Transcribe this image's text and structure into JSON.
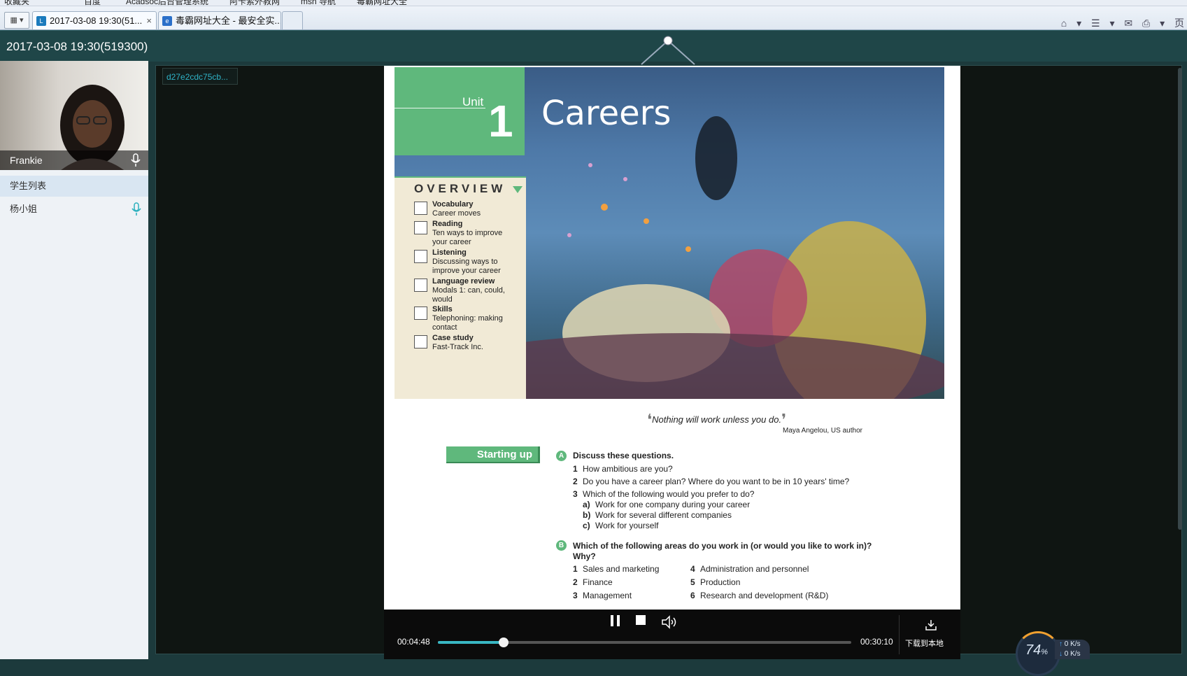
{
  "browser": {
    "favorites": [
      "收藏夹",
      "百度",
      "Acadsoc后台管理系统",
      "阿卡索外教网",
      "msn 导航",
      "毒霸网址大全"
    ],
    "tab_control": "▾",
    "tabs": [
      {
        "label": "2017-03-08 19:30(51...",
        "close": "×"
      },
      {
        "label": "毒霸网址大全 - 最安全实..."
      }
    ],
    "tools": [
      "⌂",
      "▾",
      "☰",
      "▾",
      "✉",
      "⎙",
      "▾",
      "页"
    ]
  },
  "app": {
    "title": "2017-03-08 19:30(519300)",
    "doc_id": "d27e2cdc75cb..."
  },
  "sidebar": {
    "teacher_name": "Frankie",
    "student_list_label": "学生列表",
    "students": [
      {
        "name": "杨小姐"
      }
    ]
  },
  "document": {
    "unit_label": "Unit",
    "unit_number": "1",
    "title": "Careers",
    "overview_title": "OVERVIEW",
    "overview_items": [
      {
        "heading": "Vocabulary",
        "sub": "Career moves"
      },
      {
        "heading": "Reading",
        "sub": "Ten ways to improve your career"
      },
      {
        "heading": "Listening",
        "sub": "Discussing ways to improve your career"
      },
      {
        "heading": "Language review",
        "sub": "Modals 1: can, could, would"
      },
      {
        "heading": "Skills",
        "sub": "Telephoning: making contact"
      },
      {
        "heading": "Case study",
        "sub": "Fast-Track Inc."
      }
    ],
    "quote": "Nothing will work unless you do.",
    "quote_open": "❛",
    "quote_close": "❜",
    "quote_author": "Maya Angelou,  US author",
    "section_label": "Starting up",
    "a_badge": "A",
    "a_heading": "Discuss these questions.",
    "a_questions": [
      {
        "n": "1",
        "text": "How ambitious are you?"
      },
      {
        "n": "2",
        "text": "Do you have a career plan? Where do you want to be in 10 years' time?"
      },
      {
        "n": "3",
        "text": "Which of the following would you prefer to do?"
      }
    ],
    "a_options": [
      {
        "n": "a)",
        "text": "Work for one company during your career"
      },
      {
        "n": "b)",
        "text": "Work for several different companies"
      },
      {
        "n": "c)",
        "text": "Work for yourself"
      }
    ],
    "b_badge": "B",
    "b_heading_1": "Which of the following areas do you work in (or would you like to work in)?",
    "b_heading_2": "Why?",
    "b_areas_left": [
      {
        "n": "1",
        "text": "Sales and marketing"
      },
      {
        "n": "2",
        "text": "Finance"
      },
      {
        "n": "3",
        "text": "Management"
      }
    ],
    "b_areas_right": [
      {
        "n": "4",
        "text": "Administration and personnel"
      },
      {
        "n": "5",
        "text": "Production"
      },
      {
        "n": "6",
        "text": "Research and development (R&D)"
      }
    ]
  },
  "player": {
    "current_time": "00:04:48",
    "total_time": "00:30:10",
    "progress": 0.159,
    "download_label": "下载到本地"
  },
  "network": {
    "percent": "74",
    "percent_unit": "%",
    "up": "0 K/s",
    "down": "0 K/s"
  },
  "colors": {
    "accent_green": "#5fb87c",
    "progress": "#39b7c4",
    "frame": "#1f4648"
  }
}
